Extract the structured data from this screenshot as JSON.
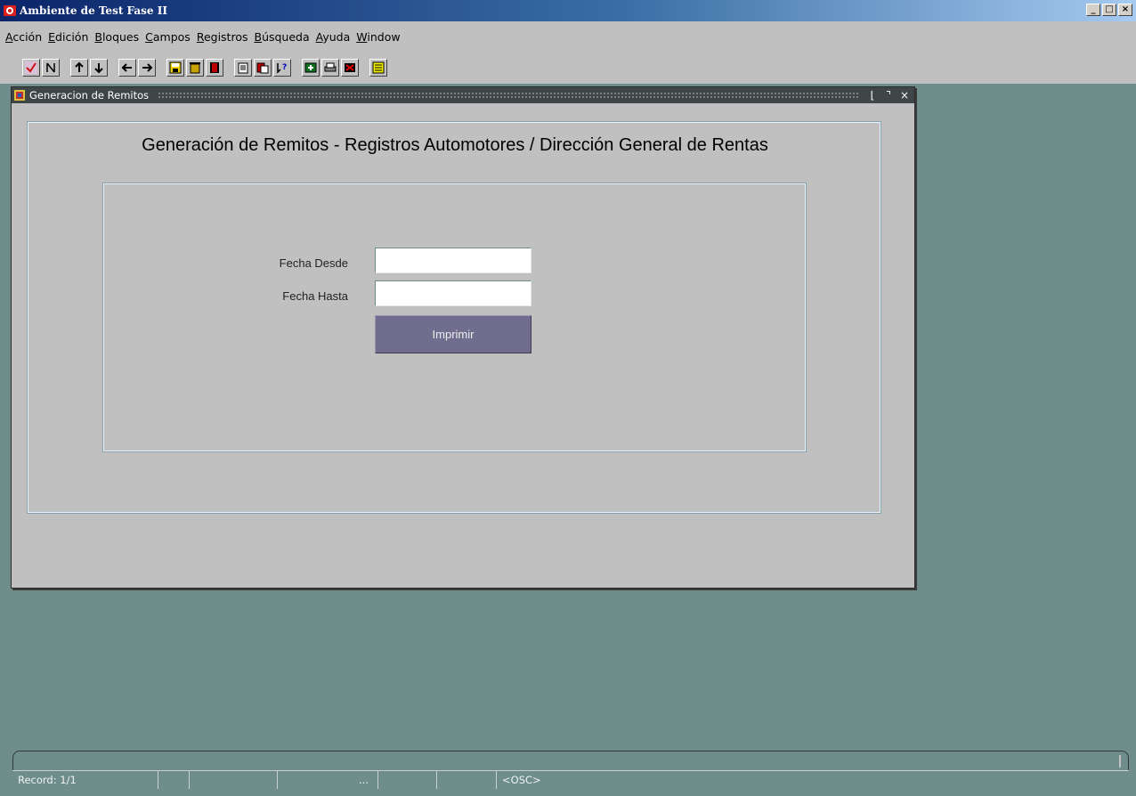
{
  "app": {
    "title": "Ambiente de Test Fase II",
    "controls": {
      "minimize": "_",
      "maximize": "□",
      "close": "×"
    }
  },
  "menu": {
    "items": [
      {
        "label": "Acción",
        "mnemonic": "A",
        "rest": "cción"
      },
      {
        "label": "Edición",
        "mnemonic": "E",
        "rest": "dición"
      },
      {
        "label": "Bloques",
        "mnemonic": "B",
        "rest": "loques"
      },
      {
        "label": "Campos",
        "mnemonic": "C",
        "rest": "ampos"
      },
      {
        "label": "Registros",
        "mnemonic": "R",
        "rest": "egistros"
      },
      {
        "label": "Búsqueda",
        "mnemonic": "B",
        "rest": "úsqueda"
      },
      {
        "label": "Ayuda",
        "mnemonic": "A",
        "rest": "yuda"
      },
      {
        "label": "Window",
        "mnemonic": "W",
        "rest": "indow"
      }
    ]
  },
  "toolbar": {
    "icons": [
      "accept-icon",
      "cancel-query-icon",
      "up-arrow-icon",
      "down-arrow-icon",
      "left-arrow-icon",
      "right-arrow-icon",
      "save-icon",
      "trash-icon",
      "exit-icon",
      "copy-icon",
      "paste-icon",
      "help-icon",
      "insert-record-icon",
      "print-icon",
      "delete-record-icon",
      "list-icon"
    ]
  },
  "window": {
    "title": "Generacion de Remitos",
    "controls": {
      "minimize": "⌊",
      "maximize": "⌝",
      "close": "×"
    }
  },
  "form": {
    "heading": "Generación de Remitos - Registros Automotores / Dirección General de Rentas",
    "fecha_desde_label": "Fecha Desde",
    "fecha_desde_value": "",
    "fecha_hasta_label": "Fecha Hasta",
    "fecha_hasta_value": "",
    "print_button_label": "Imprimir"
  },
  "status": {
    "record": "Record: 1/1",
    "cell2": "",
    "cell3": "",
    "cell4": "...",
    "cell5": "",
    "cell6": "",
    "mode": "<OSC>"
  },
  "colors": {
    "desktop": "#6f8d8a",
    "panel": "#c0c0c0",
    "button": "#706d8f",
    "titlebar_inner": "#3f4648"
  }
}
